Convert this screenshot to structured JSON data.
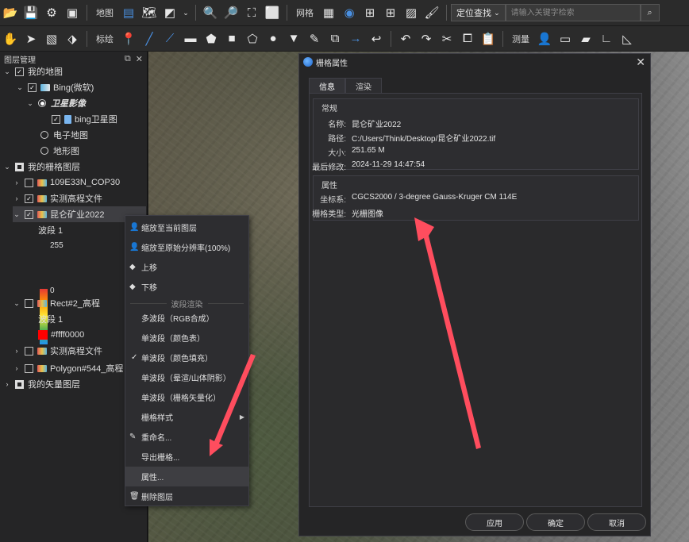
{
  "toolbar1": {
    "map_label": "地图",
    "grid_label": "网格",
    "locate_combo": "定位查找",
    "search_placeholder": "请输入关键字检索"
  },
  "toolbar2": {
    "annotate_label": "标绘",
    "measure_label": "测量"
  },
  "layer_panel": {
    "title": "图层管理",
    "my_map": "我的地图",
    "bing": "Bing(微软)",
    "satellite": "卫星影像",
    "bing_satellite": "bing卫星图",
    "electronic_map": "电子地图",
    "terrain_map": "地形图",
    "my_raster_layers": "我的栅格图层",
    "layer_cop30": "109E33N_COP30",
    "layer_elev1": "实测高程文件",
    "layer_kunlun": "昆仑矿业2022",
    "band1_a": "波段 1",
    "ramp_max": "255",
    "ramp_min": "0",
    "layer_rect": "Rect#2_高程",
    "band1_b": "波段 1",
    "swatch_label": "#ffff0000",
    "layer_elev2": "实测高程文件",
    "layer_polygon": "Polygon#544_高程",
    "my_vector_layers": "我的矢量图层"
  },
  "context_menu": {
    "zoom_to_layer": "缩放至当前图层",
    "zoom_native": "缩放至原始分辨率(100%)",
    "move_up": "上移",
    "move_down": "下移",
    "band_render_header": "波段渲染",
    "multiband": "多波段（RGB合成）",
    "single_colortable": "单波段（颜色表）",
    "single_colorfill": "单波段（颜色填充）",
    "single_hillshade": "单波段（晕渲/山体阴影）",
    "single_vectorize": "单波段（栅格矢量化）",
    "raster_style": "栅格样式",
    "rename": "重命名...",
    "export_raster": "导出栅格...",
    "properties": "属性...",
    "delete_layer": "删除图层"
  },
  "dialog": {
    "title": "栅格属性",
    "tab_info": "信息",
    "tab_render": "渲染",
    "group_general": "常规",
    "name_key": "名称:",
    "name_val": "昆仑矿业2022",
    "path_key": "路径:",
    "path_val": "C:/Users/Think/Desktop/昆仑矿业2022.tif",
    "size_key": "大小:",
    "size_val": "251.65 M",
    "modified_key": "最后修改:",
    "modified_val": "2024-11-29 14:47:54",
    "group_props": "属性",
    "crs_key": "坐标系:",
    "crs_val": "CGCS2000 / 3-degree Gauss-Kruger CM 114E",
    "type_key": "栅格类型:",
    "type_val": "光栅图像",
    "apply": "应用",
    "ok": "确定",
    "cancel": "取消"
  },
  "colors": {
    "arrow": "#ff4d5e",
    "swatch": "#ff0000"
  }
}
